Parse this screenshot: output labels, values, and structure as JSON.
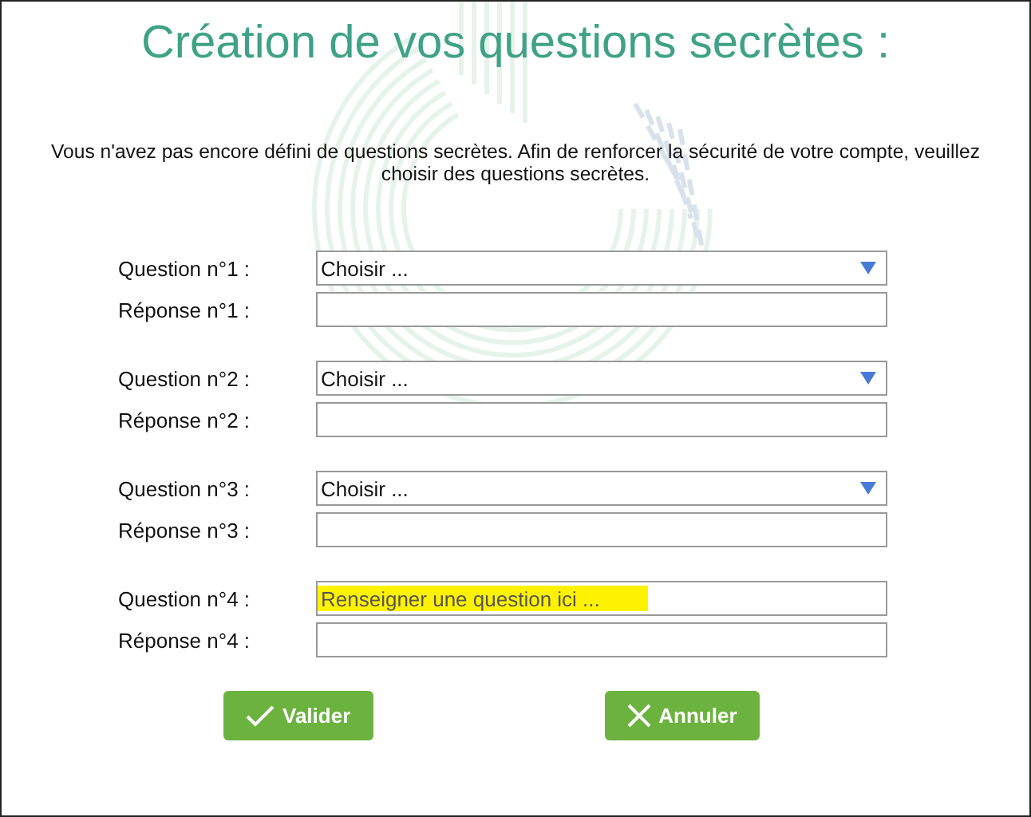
{
  "title": "Création de vos questions secrètes :",
  "intro": "Vous n'avez pas encore défini de questions secrètes. Afin de renforcer la sécurité de votre compte, veuillez choisir des questions secrètes.",
  "questions": [
    {
      "question_label": "Question n°1 :",
      "kind": "select",
      "value": "Choisir ...",
      "answer_label": "Réponse n°1 :"
    },
    {
      "question_label": "Question n°2 :",
      "kind": "select",
      "value": "Choisir ...",
      "answer_label": "Réponse n°2 :"
    },
    {
      "question_label": "Question n°3 :",
      "kind": "select",
      "value": "Choisir ...",
      "answer_label": "Réponse n°3 :"
    },
    {
      "question_label": "Question n°4 :",
      "kind": "text",
      "placeholder": "Renseigner une question ici ...",
      "highlighted": true,
      "answer_label": "Réponse n°4 :"
    }
  ],
  "buttons": [
    {
      "label": "Valider",
      "kind": "confirm"
    },
    {
      "label": "Annuler",
      "kind": "cancel"
    }
  ]
}
